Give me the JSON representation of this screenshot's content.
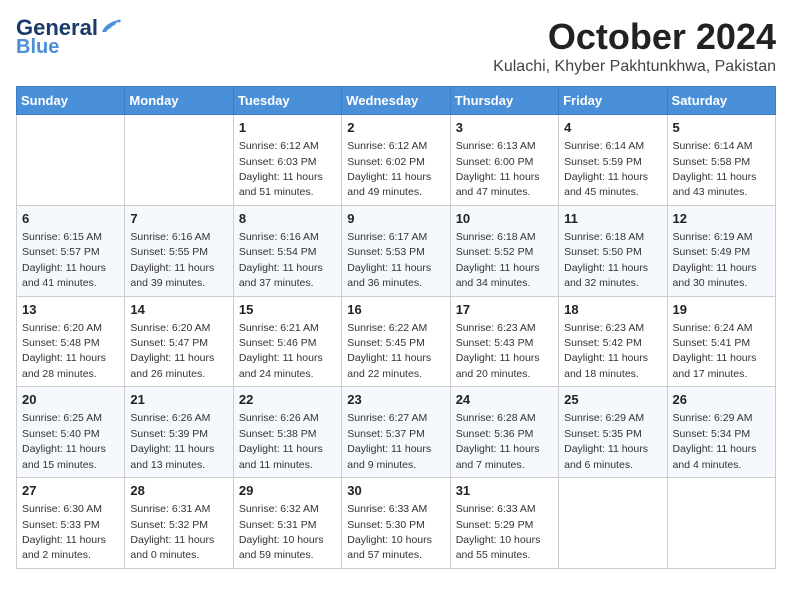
{
  "header": {
    "logo_line1": "General",
    "logo_line2": "Blue",
    "month": "October 2024",
    "location": "Kulachi, Khyber Pakhtunkhwa, Pakistan"
  },
  "weekdays": [
    "Sunday",
    "Monday",
    "Tuesday",
    "Wednesday",
    "Thursday",
    "Friday",
    "Saturday"
  ],
  "weeks": [
    [
      null,
      null,
      {
        "day": 1,
        "sunrise": "6:12 AM",
        "sunset": "6:03 PM",
        "daylight": "11 hours and 51 minutes."
      },
      {
        "day": 2,
        "sunrise": "6:12 AM",
        "sunset": "6:02 PM",
        "daylight": "11 hours and 49 minutes."
      },
      {
        "day": 3,
        "sunrise": "6:13 AM",
        "sunset": "6:00 PM",
        "daylight": "11 hours and 47 minutes."
      },
      {
        "day": 4,
        "sunrise": "6:14 AM",
        "sunset": "5:59 PM",
        "daylight": "11 hours and 45 minutes."
      },
      {
        "day": 5,
        "sunrise": "6:14 AM",
        "sunset": "5:58 PM",
        "daylight": "11 hours and 43 minutes."
      }
    ],
    [
      {
        "day": 6,
        "sunrise": "6:15 AM",
        "sunset": "5:57 PM",
        "daylight": "11 hours and 41 minutes."
      },
      {
        "day": 7,
        "sunrise": "6:16 AM",
        "sunset": "5:55 PM",
        "daylight": "11 hours and 39 minutes."
      },
      {
        "day": 8,
        "sunrise": "6:16 AM",
        "sunset": "5:54 PM",
        "daylight": "11 hours and 37 minutes."
      },
      {
        "day": 9,
        "sunrise": "6:17 AM",
        "sunset": "5:53 PM",
        "daylight": "11 hours and 36 minutes."
      },
      {
        "day": 10,
        "sunrise": "6:18 AM",
        "sunset": "5:52 PM",
        "daylight": "11 hours and 34 minutes."
      },
      {
        "day": 11,
        "sunrise": "6:18 AM",
        "sunset": "5:50 PM",
        "daylight": "11 hours and 32 minutes."
      },
      {
        "day": 12,
        "sunrise": "6:19 AM",
        "sunset": "5:49 PM",
        "daylight": "11 hours and 30 minutes."
      }
    ],
    [
      {
        "day": 13,
        "sunrise": "6:20 AM",
        "sunset": "5:48 PM",
        "daylight": "11 hours and 28 minutes."
      },
      {
        "day": 14,
        "sunrise": "6:20 AM",
        "sunset": "5:47 PM",
        "daylight": "11 hours and 26 minutes."
      },
      {
        "day": 15,
        "sunrise": "6:21 AM",
        "sunset": "5:46 PM",
        "daylight": "11 hours and 24 minutes."
      },
      {
        "day": 16,
        "sunrise": "6:22 AM",
        "sunset": "5:45 PM",
        "daylight": "11 hours and 22 minutes."
      },
      {
        "day": 17,
        "sunrise": "6:23 AM",
        "sunset": "5:43 PM",
        "daylight": "11 hours and 20 minutes."
      },
      {
        "day": 18,
        "sunrise": "6:23 AM",
        "sunset": "5:42 PM",
        "daylight": "11 hours and 18 minutes."
      },
      {
        "day": 19,
        "sunrise": "6:24 AM",
        "sunset": "5:41 PM",
        "daylight": "11 hours and 17 minutes."
      }
    ],
    [
      {
        "day": 20,
        "sunrise": "6:25 AM",
        "sunset": "5:40 PM",
        "daylight": "11 hours and 15 minutes."
      },
      {
        "day": 21,
        "sunrise": "6:26 AM",
        "sunset": "5:39 PM",
        "daylight": "11 hours and 13 minutes."
      },
      {
        "day": 22,
        "sunrise": "6:26 AM",
        "sunset": "5:38 PM",
        "daylight": "11 hours and 11 minutes."
      },
      {
        "day": 23,
        "sunrise": "6:27 AM",
        "sunset": "5:37 PM",
        "daylight": "11 hours and 9 minutes."
      },
      {
        "day": 24,
        "sunrise": "6:28 AM",
        "sunset": "5:36 PM",
        "daylight": "11 hours and 7 minutes."
      },
      {
        "day": 25,
        "sunrise": "6:29 AM",
        "sunset": "5:35 PM",
        "daylight": "11 hours and 6 minutes."
      },
      {
        "day": 26,
        "sunrise": "6:29 AM",
        "sunset": "5:34 PM",
        "daylight": "11 hours and 4 minutes."
      }
    ],
    [
      {
        "day": 27,
        "sunrise": "6:30 AM",
        "sunset": "5:33 PM",
        "daylight": "11 hours and 2 minutes."
      },
      {
        "day": 28,
        "sunrise": "6:31 AM",
        "sunset": "5:32 PM",
        "daylight": "11 hours and 0 minutes."
      },
      {
        "day": 29,
        "sunrise": "6:32 AM",
        "sunset": "5:31 PM",
        "daylight": "10 hours and 59 minutes."
      },
      {
        "day": 30,
        "sunrise": "6:33 AM",
        "sunset": "5:30 PM",
        "daylight": "10 hours and 57 minutes."
      },
      {
        "day": 31,
        "sunrise": "6:33 AM",
        "sunset": "5:29 PM",
        "daylight": "10 hours and 55 minutes."
      },
      null,
      null
    ]
  ]
}
